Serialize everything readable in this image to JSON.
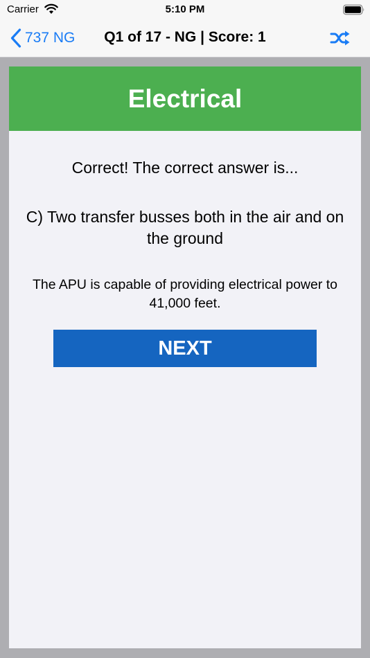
{
  "status_bar": {
    "carrier": "Carrier",
    "time": "5:10 PM"
  },
  "nav": {
    "back_label": "737 NG",
    "title": "Q1 of 17 - NG | Score: 1",
    "accent_color": "#1a7cf5"
  },
  "card": {
    "category": "Electrical",
    "category_color": "#4caf50",
    "result": "Correct! The correct answer is...",
    "answer": "C) Two transfer busses both in the air and on the ground",
    "explanation": "The APU is capable of providing electrical power to 41,000 feet.",
    "next_label": "NEXT",
    "next_color": "#1565c0"
  },
  "icons": {
    "wifi": "wifi-icon",
    "battery": "battery-icon",
    "back": "chevron-left-icon",
    "shuffle": "shuffle-icon"
  }
}
